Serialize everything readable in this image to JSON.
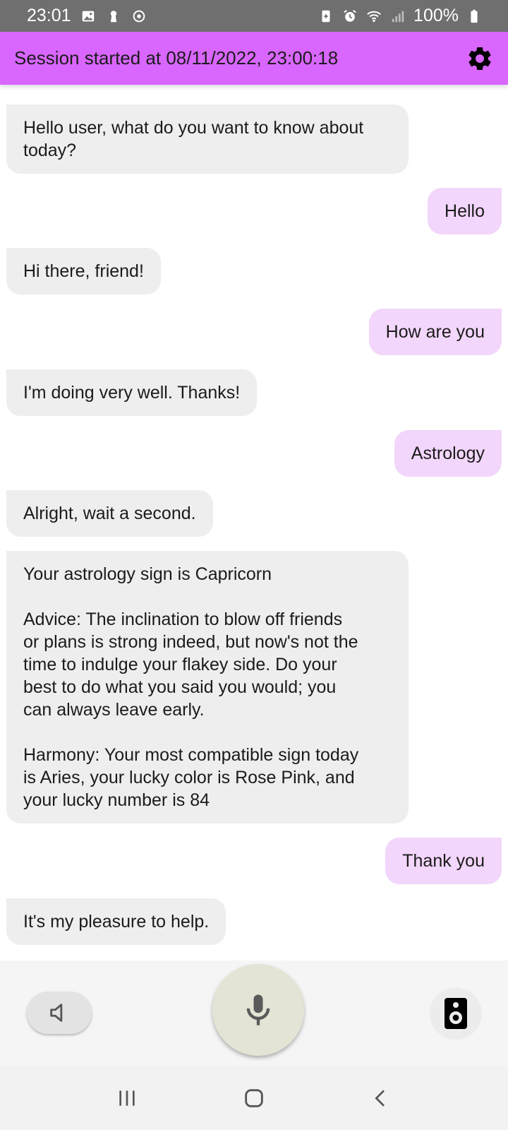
{
  "status_bar": {
    "time": "23:01",
    "battery": "100%",
    "left_icons": [
      "gallery-icon",
      "keyhole-icon",
      "sync-icon"
    ],
    "right_icons": [
      "battery-saver-icon",
      "alarm-icon",
      "wifi-icon",
      "signal-icon",
      "battery-icon"
    ]
  },
  "header": {
    "title": "Session started at 08/11/2022, 23:00:18",
    "background": "#d966ff",
    "settings_icon": "gear-icon"
  },
  "chat": {
    "bot_bubble_color": "#eeeeee",
    "user_bubble_color": "#f3d6fb",
    "messages": [
      {
        "sender": "bot",
        "text": "Hello user, what do you want to know about\ntoday?"
      },
      {
        "sender": "user",
        "text": "Hello"
      },
      {
        "sender": "bot",
        "text": "Hi there, friend!"
      },
      {
        "sender": "user",
        "text": "How are you"
      },
      {
        "sender": "bot",
        "text": "I'm doing very well. Thanks!"
      },
      {
        "sender": "user",
        "text": "Astrology"
      },
      {
        "sender": "bot",
        "text": "Alright, wait a second."
      },
      {
        "sender": "bot",
        "text": "Your astrology sign is Capricorn\n\nAdvice: The inclination to blow off friends\nor plans is strong indeed, but now's not the\ntime to indulge your flakey side. Do your\nbest to do what you said you would; you\ncan always leave early.\n\nHarmony: Your most compatible sign today\nis Aries, your lucky color is Rose Pink, and\nyour lucky number is 84"
      },
      {
        "sender": "user",
        "text": "Thank you"
      },
      {
        "sender": "bot",
        "text": "It's my pleasure to help."
      }
    ]
  },
  "controls": {
    "mute_icon": "volume-icon",
    "mic_icon": "microphone-icon",
    "speaker_icon": "speaker-icon"
  },
  "nav_bar": {
    "buttons": [
      "recent-apps-icon",
      "home-icon",
      "back-icon"
    ]
  }
}
